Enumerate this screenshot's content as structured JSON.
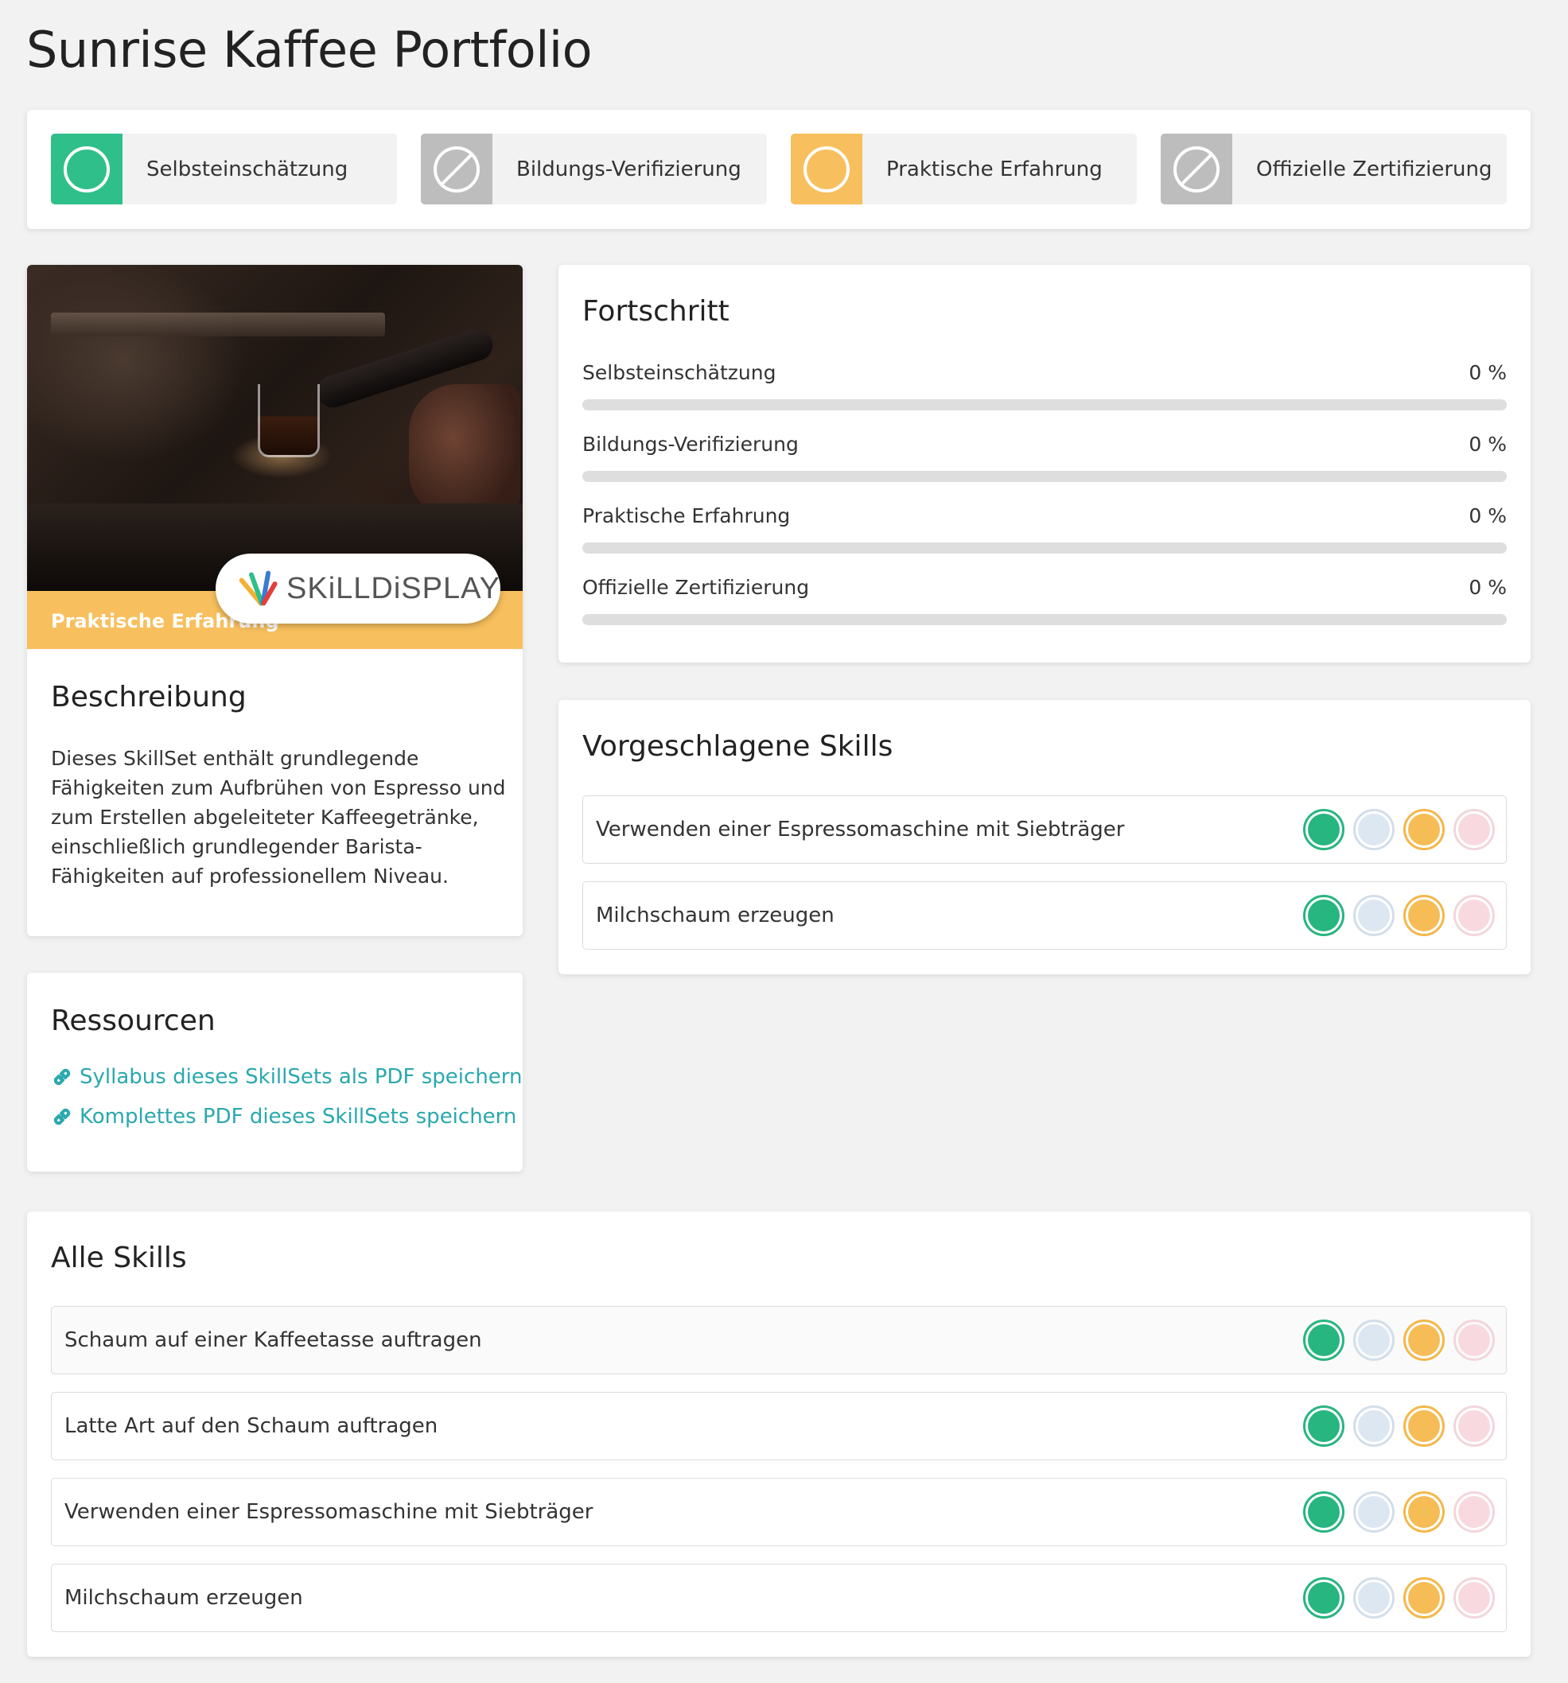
{
  "page": {
    "title": "Sunrise Kaffee Portfolio"
  },
  "colors": {
    "self": "#2fbf8a",
    "education": "#bdbdbd",
    "practical": "#f7bf5d",
    "certification": "#bdbdbd",
    "link": "#2aa8ae"
  },
  "verification_tiles": [
    {
      "label": "Selbsteinschätzung",
      "icon": "circle-icon",
      "active": true,
      "color": "#2fbf8a"
    },
    {
      "label": "Bildungs-Verifizierung",
      "icon": "no-entry-icon",
      "active": false,
      "color": "#bdbdbd"
    },
    {
      "label": "Praktische Erfahrung",
      "icon": "circle-icon",
      "active": true,
      "color": "#f7bf5d"
    },
    {
      "label": "Offizielle Zertifizierung",
      "icon": "no-entry-icon",
      "active": false,
      "color": "#bdbdbd"
    }
  ],
  "skillset_card": {
    "band_label": "Praktische Erfahrung",
    "brand": "SKiLLDiSPLAY",
    "description_heading": "Beschreibung",
    "description": "Dieses SkillSet enthält grundlegende Fähigkeiten zum Aufbrühen von Espresso und zum Erstellen abgeleiteter Kaffeegetränke, einschließlich grundlegender Barista-Fähigkeiten auf professionellem Niveau."
  },
  "resources": {
    "heading": "Ressourcen",
    "links": [
      {
        "label": "Syllabus dieses SkillSets als PDF speichern"
      },
      {
        "label": "Komplettes PDF dieses SkillSets speichern"
      }
    ]
  },
  "progress": {
    "heading": "Fortschritt",
    "items": [
      {
        "label": "Selbsteinschätzung",
        "value_text": "0 %",
        "percent": 0
      },
      {
        "label": "Bildungs-Verifizierung",
        "value_text": "0 %",
        "percent": 0
      },
      {
        "label": "Praktische Erfahrung",
        "value_text": "0 %",
        "percent": 0
      },
      {
        "label": "Offizielle Zertifizierung",
        "value_text": "0 %",
        "percent": 0
      }
    ]
  },
  "suggested_skills": {
    "heading": "Vorgeschlagene Skills",
    "items": [
      {
        "label": "Verwenden einer Espressomaschine mit Siebträger"
      },
      {
        "label": "Milchschaum erzeugen"
      }
    ]
  },
  "all_skills": {
    "heading": "Alle Skills",
    "items": [
      {
        "label": "Schaum auf einer Kaffeetasse auftragen"
      },
      {
        "label": "Latte Art auf den Schaum auftragen"
      },
      {
        "label": "Verwenden einer Espressomaschine mit Siebträger"
      },
      {
        "label": "Milchschaum erzeugen"
      }
    ]
  }
}
